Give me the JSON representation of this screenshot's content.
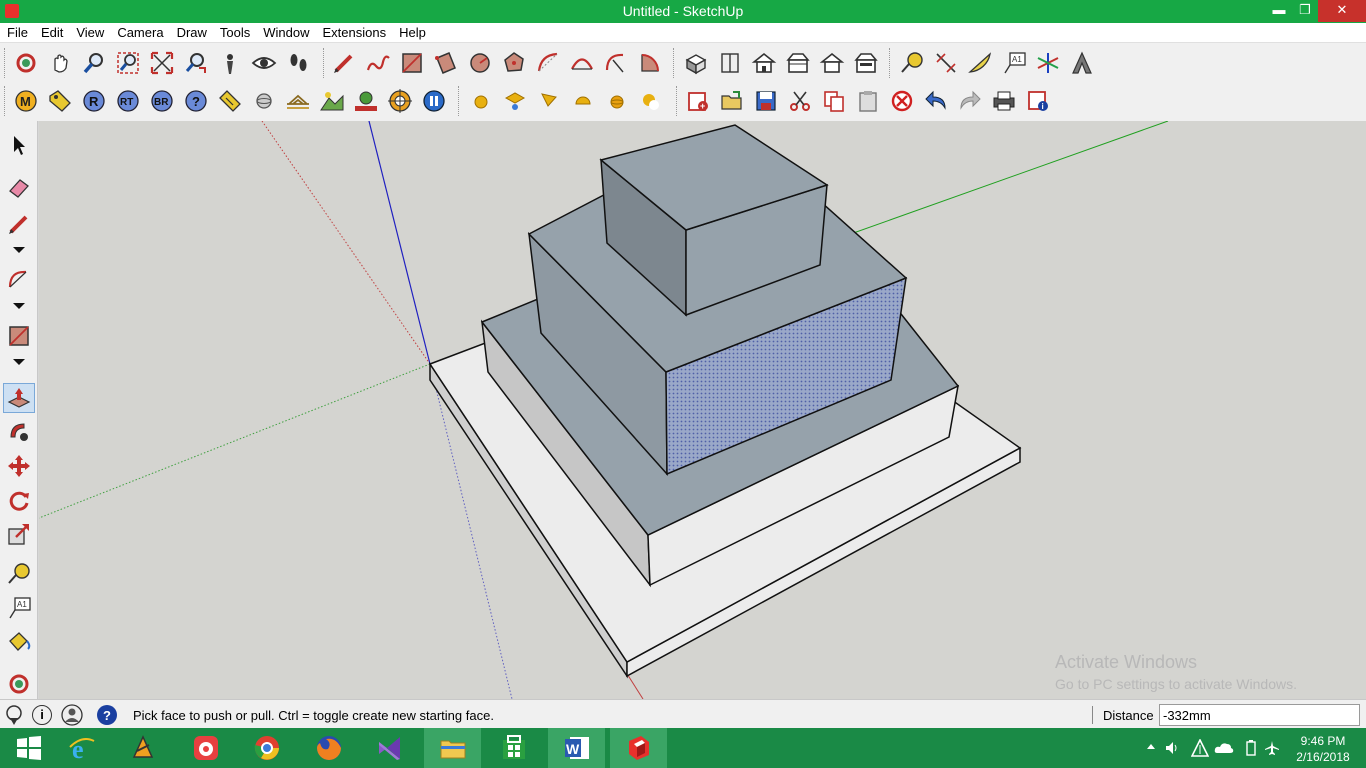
{
  "window": {
    "title": "Untitled - SketchUp",
    "minimize": "▬",
    "restore": "❐",
    "close": "✕"
  },
  "menu": [
    "File",
    "Edit",
    "View",
    "Camera",
    "Draw",
    "Tools",
    "Window",
    "Extensions",
    "Help"
  ],
  "toolbar_row1": [
    [
      "orbit-icon",
      "pan-icon",
      "zoom-icon",
      "zoom-window-icon",
      "zoom-extents-icon",
      "previous-view-icon",
      "position-camera-icon",
      "look-around-icon",
      "walk-icon"
    ],
    [
      "pencil-line-icon",
      "freehand-icon",
      "rectangle-icon",
      "rotated-rectangle-icon",
      "circle-icon",
      "polygon-icon",
      "arc-icon",
      "two-point-arc-icon",
      "three-point-arc-icon",
      "pie-icon"
    ],
    [
      "iso-view-icon",
      "top-view-icon",
      "front-view-icon",
      "right-view-icon",
      "back-view-icon",
      "left-view-icon"
    ],
    [
      "tape-measure-icon",
      "dimension-icon",
      "protractor-icon",
      "text-icon",
      "axes-icon",
      "3d-text-icon"
    ]
  ],
  "toolbar_row2": [
    [
      "m-badge-icon",
      "tag-icon",
      "r-badge-icon",
      "rt-badge-icon",
      "br-badge-icon",
      "help-badge-icon",
      "label-tag-icon",
      "sphere-icon",
      "bridge-icon",
      "landscape-icon",
      "tree-landscape-icon",
      "target-icon",
      "pause-icon"
    ],
    [
      "yellow-sphere-icon",
      "sun-shadow-icon",
      "flag-icon",
      "half-sphere-icon",
      "gold-sphere-icon",
      "glow-sphere-icon"
    ],
    [
      "new-model-icon",
      "open-icon",
      "save-icon",
      "cut-icon",
      "copy-icon",
      "paste-icon",
      "erase-selection-icon",
      "undo-icon",
      "redo-icon",
      "print-icon",
      "model-info-icon"
    ]
  ],
  "left_toolbar": [
    "select-icon",
    "eraser-icon",
    "line-tool-icon",
    "arc-tool-icon",
    "shape-tool-icon",
    "push-pull-icon",
    "follow-me-icon",
    "move-icon",
    "rotate-icon",
    "scale-icon",
    "tape-tool-icon",
    "text-tool-icon",
    "paint-bucket-icon",
    "orbit-tool-icon"
  ],
  "status": {
    "message": "Pick face to push or pull.  Ctrl = toggle create new starting face.",
    "distance_label": "Distance",
    "distance_value": "-332mm"
  },
  "watermark": {
    "line1": "Activate Windows",
    "line2": "Go to PC settings to activate Windows."
  },
  "taskbar": {
    "apps": [
      "start-icon",
      "internet-explorer-icon",
      "winamp-icon",
      "app-red-icon",
      "chrome-icon",
      "firefox-icon",
      "visual-studio-icon",
      "file-explorer-icon",
      "store-icon",
      "word-icon",
      "sketchup-icon"
    ],
    "time": "9:46 PM",
    "date": "2/16/2018"
  },
  "colors": {
    "titlebar": "#17a845",
    "taskbar": "#1a8a46",
    "viewport_bg": "#d4d4d0",
    "face_blue": "#96a2ab",
    "face_white": "#ececec"
  }
}
